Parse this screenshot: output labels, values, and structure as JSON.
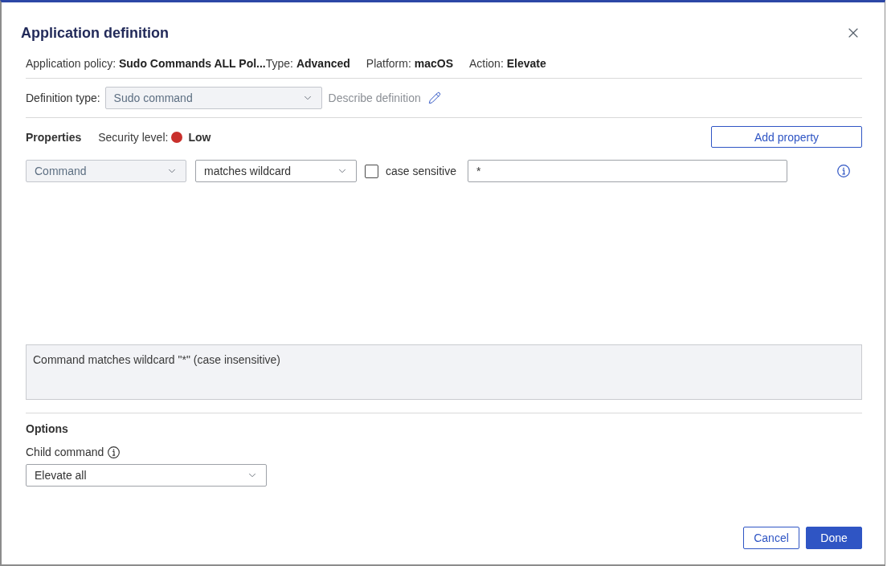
{
  "dialog": {
    "title": "Application definition"
  },
  "policy_info": [
    "Application policy: **Sudo Commands ALL Pol...**",
    "Type: **Advanced**",
    "Platform: **macOS**",
    "Action: **Elevate**"
  ],
  "definition_type": {
    "label": "Definition type:",
    "value": "Sudo command",
    "disabled": true,
    "describe_link": "Describe definition"
  },
  "properties": {
    "heading": "Properties",
    "security": {
      "label": "Security level:",
      "value": "Low",
      "color": "#c9302c"
    },
    "add_button": "Add property",
    "rows": [
      {
        "field": {
          "value": "Command",
          "disabled": true
        },
        "operator": {
          "value": "matches wildcard",
          "disabled": false
        },
        "case_sensitive": {
          "label": "case sensitive",
          "checked": false
        },
        "pattern": "*"
      }
    ]
  },
  "summary": "Command matches wildcard \"*\" (case insensitive)",
  "options": {
    "heading": "Options",
    "child_command": {
      "label": "Child command",
      "value": "Elevate all",
      "disabled": false
    }
  },
  "buttons": [
    {
      "label": "Cancel",
      "kind": "secondary"
    },
    {
      "label": "Done",
      "kind": "primary"
    }
  ]
}
